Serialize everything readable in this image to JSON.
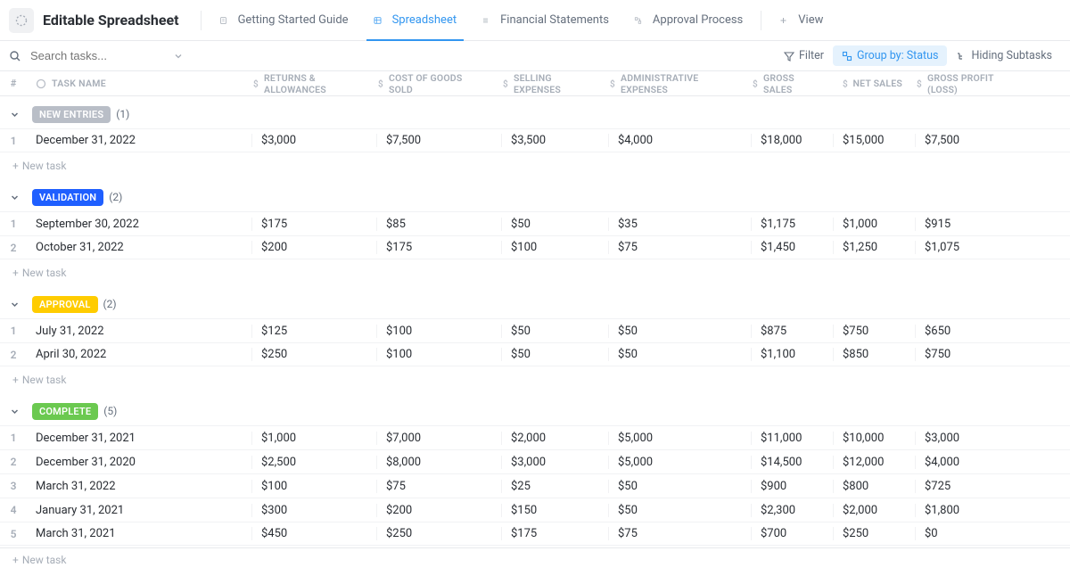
{
  "header": {
    "title": "Editable Spreadsheet",
    "tabs": [
      {
        "label": "Getting Started Guide"
      },
      {
        "label": "Spreadsheet"
      },
      {
        "label": "Financial Statements"
      },
      {
        "label": "Approval Process"
      },
      {
        "label": "View"
      }
    ]
  },
  "toolbar": {
    "search_placeholder": "Search tasks...",
    "filter_label": "Filter",
    "groupby_label": "Group by: Status",
    "hiding_label": "Hiding Subtasks"
  },
  "columns": {
    "num": "#",
    "name": "TASK NAME",
    "c1": "RETURNS & ALLOWANCES",
    "c2": "COST OF GOODS SOLD",
    "c3": "SELLING EXPENSES",
    "c4": "ADMINISTRATIVE EXPENSES",
    "c5": "GROSS SALES",
    "c6": "NET SALES",
    "c7": "GROSS PROFIT (LOSS)"
  },
  "groups": [
    {
      "label": "NEW ENTRIES",
      "badge_class": "gray",
      "count": "(1)",
      "rows": [
        {
          "n": "1",
          "name": "December 31, 2022",
          "c1": "$3,000",
          "c2": "$7,500",
          "c3": "$3,500",
          "c4": "$4,000",
          "c5": "$18,000",
          "c6": "$15,000",
          "c7": "$7,500"
        }
      ]
    },
    {
      "label": "VALIDATION",
      "badge_class": "blue",
      "count": "(2)",
      "rows": [
        {
          "n": "1",
          "name": "September 30, 2022",
          "c1": "$175",
          "c2": "$85",
          "c3": "$50",
          "c4": "$35",
          "c5": "$1,175",
          "c6": "$1,000",
          "c7": "$915"
        },
        {
          "n": "2",
          "name": "October 31, 2022",
          "c1": "$200",
          "c2": "$175",
          "c3": "$100",
          "c4": "$75",
          "c5": "$1,450",
          "c6": "$1,250",
          "c7": "$1,075"
        }
      ]
    },
    {
      "label": "APPROVAL",
      "badge_class": "yellow",
      "count": "(2)",
      "rows": [
        {
          "n": "1",
          "name": "July 31, 2022",
          "c1": "$125",
          "c2": "$100",
          "c3": "$50",
          "c4": "$50",
          "c5": "$875",
          "c6": "$750",
          "c7": "$650"
        },
        {
          "n": "2",
          "name": "April 30, 2022",
          "c1": "$250",
          "c2": "$100",
          "c3": "$50",
          "c4": "$50",
          "c5": "$1,100",
          "c6": "$850",
          "c7": "$750"
        }
      ]
    },
    {
      "label": "COMPLETE",
      "badge_class": "green",
      "count": "(5)",
      "rows": [
        {
          "n": "1",
          "name": "December 31, 2021",
          "c1": "$1,000",
          "c2": "$7,000",
          "c3": "$2,000",
          "c4": "$5,000",
          "c5": "$11,000",
          "c6": "$10,000",
          "c7": "$3,000"
        },
        {
          "n": "2",
          "name": "December 31, 2020",
          "c1": "$2,500",
          "c2": "$8,000",
          "c3": "$3,000",
          "c4": "$5,000",
          "c5": "$14,500",
          "c6": "$12,000",
          "c7": "$4,000"
        },
        {
          "n": "3",
          "name": "March 31, 2022",
          "c1": "$100",
          "c2": "$75",
          "c3": "$25",
          "c4": "$50",
          "c5": "$900",
          "c6": "$800",
          "c7": "$725"
        },
        {
          "n": "4",
          "name": "January 31, 2021",
          "c1": "$300",
          "c2": "$200",
          "c3": "$150",
          "c4": "$50",
          "c5": "$2,300",
          "c6": "$2,000",
          "c7": "$1,800"
        },
        {
          "n": "5",
          "name": "March 31, 2021",
          "c1": "$450",
          "c2": "$250",
          "c3": "$175",
          "c4": "$75",
          "c5": "$700",
          "c6": "$250",
          "c7": "$0"
        }
      ]
    }
  ],
  "newtask_label": "New task"
}
